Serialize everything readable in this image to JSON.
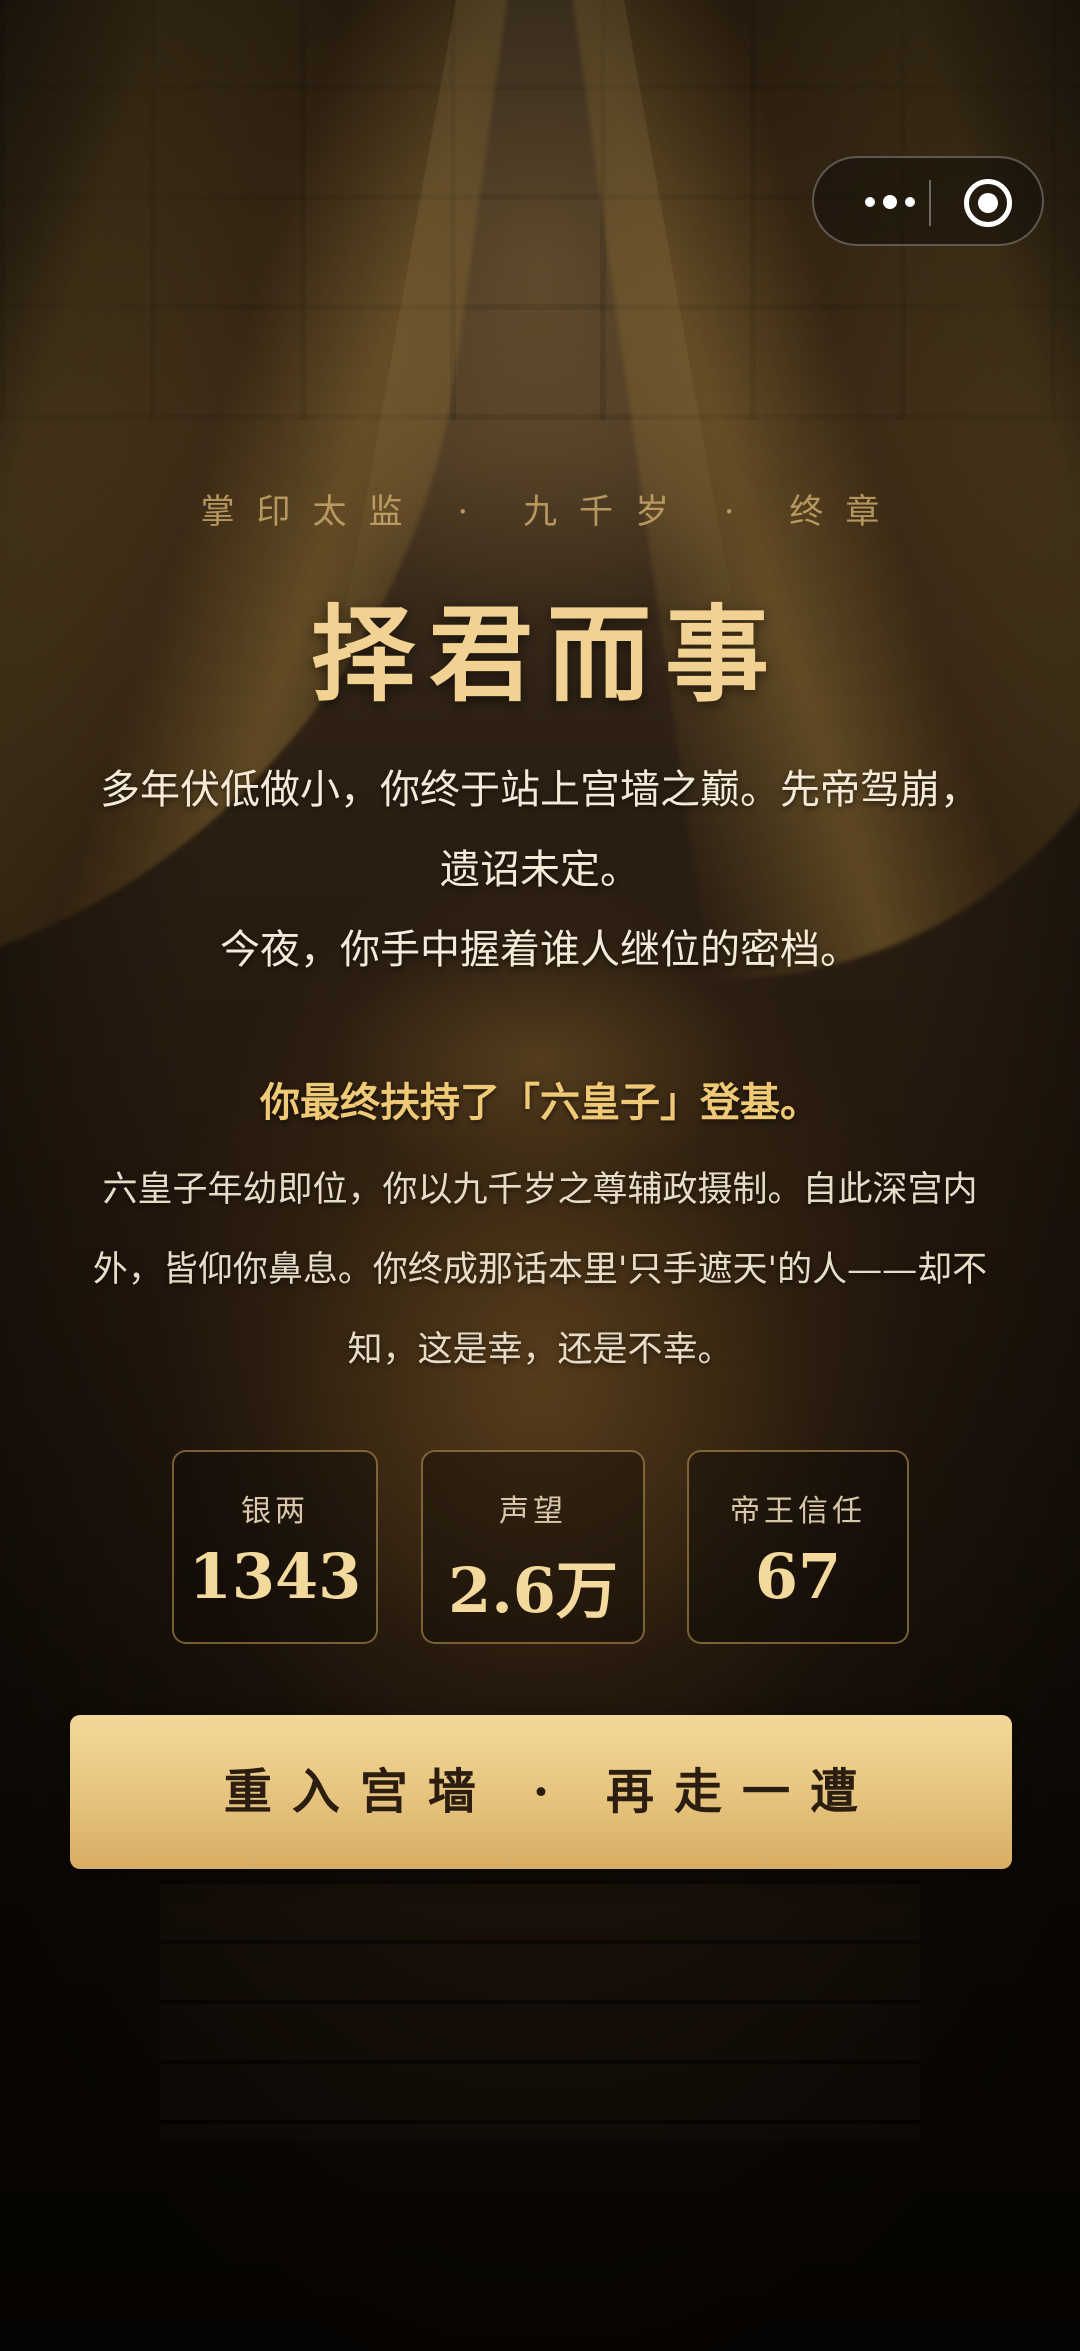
{
  "capsule": {
    "more_icon": "more-dots-icon",
    "close_icon": "target-circle-icon"
  },
  "header": {
    "subtitle": "掌印太监 · 九千岁 · 终章",
    "title": "择君而事"
  },
  "intro": {
    "line1": "多年伏低做小，你终于站上宫墙之巅。先帝驾崩，遗诏未定。",
    "line2": "今夜，你手中握着谁人继位的密档。"
  },
  "ending": {
    "headline": "你最终扶持了「六皇子」登基。",
    "body": "六皇子年幼即位，你以九千岁之尊辅政摄制。自此深宫内外，皆仰你鼻息。你终成那话本里'只手遮天'的人——却不知，这是幸，还是不幸。"
  },
  "stats": [
    {
      "label": "银两",
      "value": "1343"
    },
    {
      "label": "声望",
      "value": "2.6万"
    },
    {
      "label": "帝王信任",
      "value": "67"
    }
  ],
  "actions": {
    "restart_label": "重入宫墙 · 再走一遭"
  },
  "colors": {
    "gold": "#f2d292",
    "button": "#e6c37d",
    "background": "#24180d"
  }
}
